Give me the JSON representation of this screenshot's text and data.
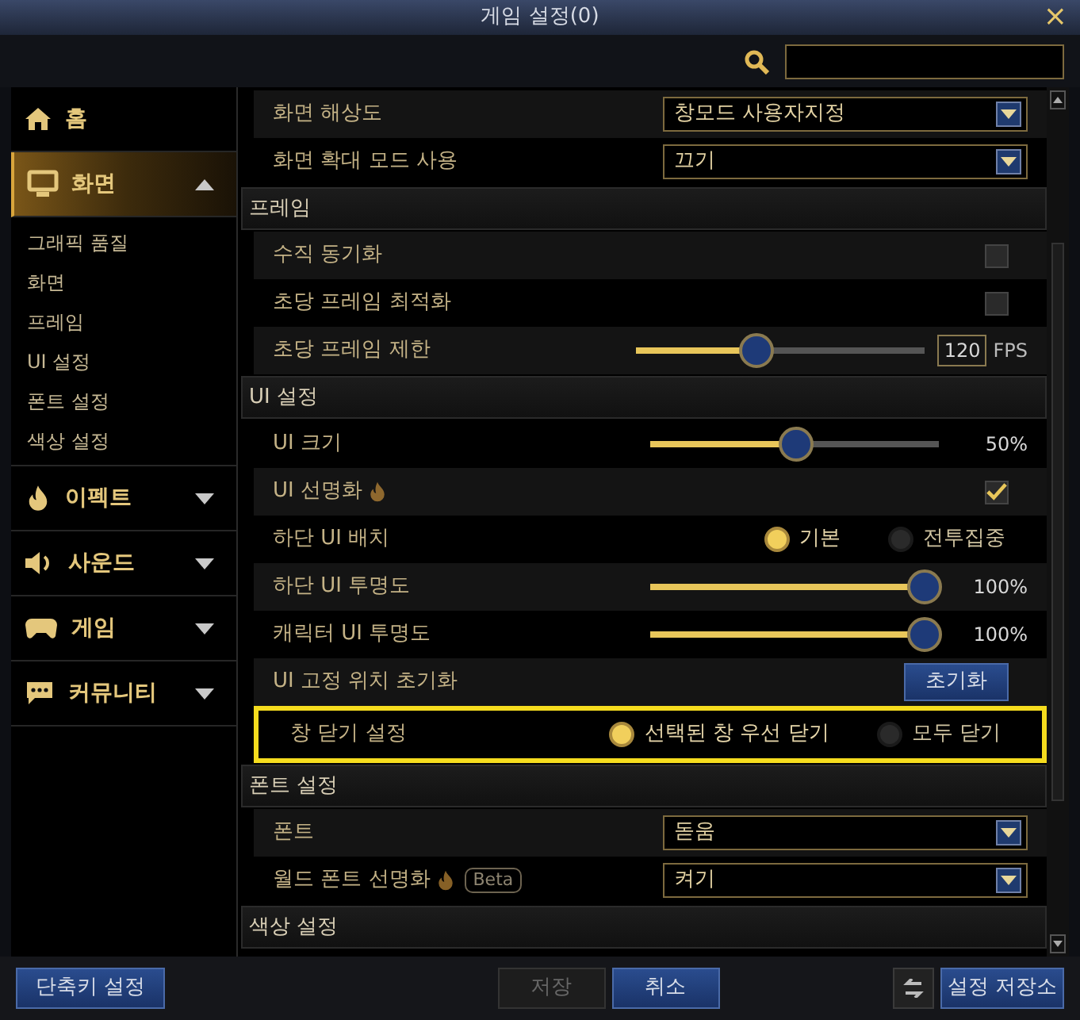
{
  "window": {
    "title": "게임 설정(0)",
    "close": "×"
  },
  "sidebar": {
    "items": [
      {
        "label": "홈",
        "selected": false
      },
      {
        "label": "화면",
        "selected": true,
        "expanded": true,
        "children": [
          {
            "label": "그래픽 품질"
          },
          {
            "label": "화면"
          },
          {
            "label": "프레임"
          },
          {
            "label": "UI 설정"
          },
          {
            "label": "폰트 설정"
          },
          {
            "label": "색상 설정"
          }
        ]
      },
      {
        "label": "이펙트",
        "selected": false,
        "expanded": false
      },
      {
        "label": "사운드",
        "selected": false,
        "expanded": false
      },
      {
        "label": "게임",
        "selected": false,
        "expanded": false
      },
      {
        "label": "커뮤니티",
        "selected": false,
        "expanded": false
      }
    ]
  },
  "settings": [
    {
      "kind": "dropdown",
      "label": "화면 해상도",
      "value": "창모드 사용자지정"
    },
    {
      "kind": "dropdown",
      "label": "화면 확대 모드 사용",
      "value": "끄기"
    },
    {
      "kind": "section",
      "label": "프레임"
    },
    {
      "kind": "checkbox",
      "label": "수직 동기화",
      "checked": false
    },
    {
      "kind": "checkbox",
      "label": "초당 프레임 최적화",
      "checked": false
    },
    {
      "kind": "slider",
      "label": "초당 프레임 제한",
      "level": 0.4,
      "reading": "120",
      "unit": "FPS"
    },
    {
      "kind": "section",
      "label": "UI 설정"
    },
    {
      "kind": "slider",
      "label": "UI 크기",
      "level": 0.5,
      "reading": "50%"
    },
    {
      "kind": "checkbox",
      "label": "UI 선명화",
      "flame": true,
      "checked": true
    },
    {
      "kind": "radio",
      "label": "하단 UI 배치",
      "options": [
        {
          "label": "기본",
          "selected": true
        },
        {
          "label": "전투집중",
          "selected": false
        }
      ]
    },
    {
      "kind": "slider",
      "label": "하단 UI 투명도",
      "level": 1,
      "reading": "100%"
    },
    {
      "kind": "slider",
      "label": "캐릭터 UI 투명도",
      "level": 1,
      "reading": "100%"
    },
    {
      "kind": "button",
      "label": "UI 고정 위치 초기화",
      "button": "초기화"
    },
    {
      "kind": "radio",
      "label": "창 닫기 설정",
      "highlighted": true,
      "options": [
        {
          "label": "선택된 창 우선 닫기",
          "selected": true
        },
        {
          "label": "모두 닫기",
          "selected": false
        }
      ]
    },
    {
      "kind": "section",
      "label": "폰트 설정"
    },
    {
      "kind": "dropdown",
      "label": "폰트",
      "value": "돋움"
    },
    {
      "kind": "dropdown",
      "label": "월드 폰트 선명화",
      "flame": true,
      "badge": "Beta",
      "value": "켜기"
    },
    {
      "kind": "section",
      "label": "색상 설정"
    }
  ],
  "footer": {
    "shortcut": "단축키 설정",
    "save": {
      "label": "저장",
      "disabled": true
    },
    "cancel": "취소",
    "storage": "설정 저장소"
  }
}
